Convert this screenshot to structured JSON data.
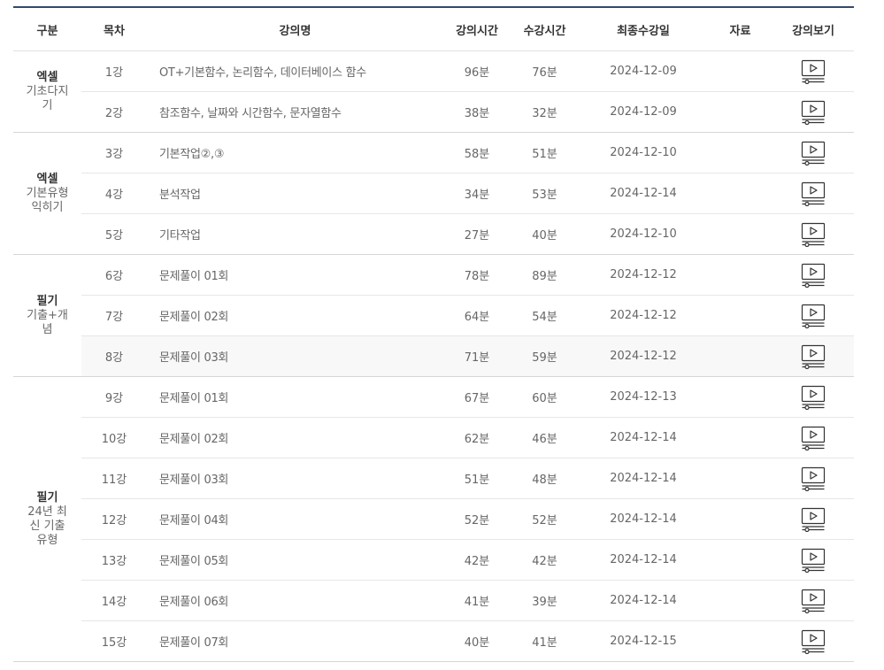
{
  "headers": {
    "group": "구분",
    "index": "목차",
    "title": "강의명",
    "duration": "강의시간",
    "watched": "수강시간",
    "last_date": "최종수강일",
    "material": "자료",
    "view": "강의보기"
  },
  "icons": {
    "play": "play-video-icon"
  },
  "colors": {
    "header_line": "#34496a"
  },
  "groups": [
    {
      "name": "엑셀",
      "sub": "기초다지기"
    },
    {
      "name": "엑셀",
      "sub": "기본유형익히기"
    },
    {
      "name": "필기",
      "sub": "기출+개념"
    },
    {
      "name": "필기",
      "sub": "24년 최신 기출유형"
    }
  ],
  "rows": [
    {
      "index": "1강",
      "title": "OT+기본함수, 논리함수, 데이터베이스 함수",
      "duration": "96분",
      "watched": "76분",
      "last_date": "2024-12-09"
    },
    {
      "index": "2강",
      "title": "참조함수, 날짜와 시간함수, 문자열함수",
      "duration": "38분",
      "watched": "32분",
      "last_date": "2024-12-09"
    },
    {
      "index": "3강",
      "title": "기본작업②,③",
      "duration": "58분",
      "watched": "51분",
      "last_date": "2024-12-10"
    },
    {
      "index": "4강",
      "title": "분석작업",
      "duration": "34분",
      "watched": "53분",
      "last_date": "2024-12-14"
    },
    {
      "index": "5강",
      "title": "기타작업",
      "duration": "27분",
      "watched": "40분",
      "last_date": "2024-12-10"
    },
    {
      "index": "6강",
      "title": "문제풀이 01회",
      "duration": "78분",
      "watched": "89분",
      "last_date": "2024-12-12"
    },
    {
      "index": "7강",
      "title": "문제풀이 02회",
      "duration": "64분",
      "watched": "54분",
      "last_date": "2024-12-12"
    },
    {
      "index": "8강",
      "title": "문제풀이 03회",
      "duration": "71분",
      "watched": "59분",
      "last_date": "2024-12-12"
    },
    {
      "index": "9강",
      "title": "문제풀이 01회",
      "duration": "67분",
      "watched": "60분",
      "last_date": "2024-12-13"
    },
    {
      "index": "10강",
      "title": "문제풀이 02회",
      "duration": "62분",
      "watched": "46분",
      "last_date": "2024-12-14"
    },
    {
      "index": "11강",
      "title": "문제풀이 03회",
      "duration": "51분",
      "watched": "48분",
      "last_date": "2024-12-14"
    },
    {
      "index": "12강",
      "title": "문제풀이 04회",
      "duration": "52분",
      "watched": "52분",
      "last_date": "2024-12-14"
    },
    {
      "index": "13강",
      "title": "문제풀이 05회",
      "duration": "42분",
      "watched": "42분",
      "last_date": "2024-12-14"
    },
    {
      "index": "14강",
      "title": "문제풀이 06회",
      "duration": "41분",
      "watched": "39분",
      "last_date": "2024-12-14"
    },
    {
      "index": "15강",
      "title": "문제풀이 07회",
      "duration": "40분",
      "watched": "41분",
      "last_date": "2024-12-15"
    }
  ]
}
